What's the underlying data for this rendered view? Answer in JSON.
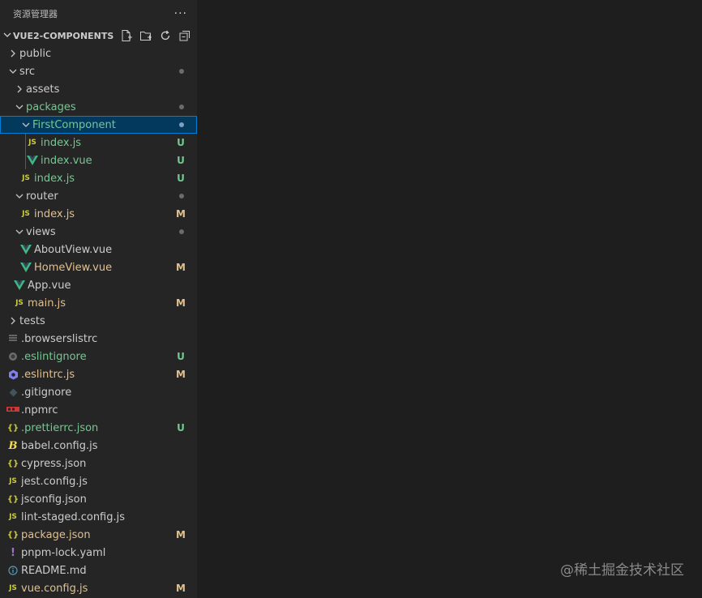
{
  "explorer": {
    "title": "资源管理器",
    "more": "···",
    "section_title": "VUE2-COMPONENTS",
    "actions": [
      "new-file-icon",
      "new-folder-icon",
      "refresh-icon",
      "collapse-all-icon"
    ]
  },
  "tree": [
    {
      "label": "public",
      "type": "folder",
      "open": false,
      "depth": 0
    },
    {
      "label": "src",
      "type": "folder",
      "open": true,
      "depth": 0,
      "status": "dot"
    },
    {
      "label": "assets",
      "type": "folder",
      "open": false,
      "depth": 1
    },
    {
      "label": "packages",
      "type": "folder",
      "open": true,
      "depth": 1,
      "status": "dot",
      "color": "green"
    },
    {
      "label": "FirstComponent",
      "type": "folder",
      "open": true,
      "depth": 2,
      "status": "dot",
      "color": "green",
      "selected": true
    },
    {
      "label": "index.js",
      "type": "js",
      "depth": 3,
      "status": "U",
      "color": "green"
    },
    {
      "label": "index.vue",
      "type": "vue",
      "depth": 3,
      "status": "U",
      "color": "green"
    },
    {
      "label": "index.js",
      "type": "js",
      "depth": 2,
      "status": "U",
      "color": "green"
    },
    {
      "label": "router",
      "type": "folder",
      "open": true,
      "depth": 1,
      "status": "dot"
    },
    {
      "label": "index.js",
      "type": "js",
      "depth": 2,
      "status": "M",
      "color": "yellow"
    },
    {
      "label": "views",
      "type": "folder",
      "open": true,
      "depth": 1,
      "status": "dot"
    },
    {
      "label": "AboutView.vue",
      "type": "vue",
      "depth": 2
    },
    {
      "label": "HomeView.vue",
      "type": "vue",
      "depth": 2,
      "status": "M",
      "color": "yellow"
    },
    {
      "label": "App.vue",
      "type": "vue",
      "depth": 1
    },
    {
      "label": "main.js",
      "type": "js",
      "depth": 1,
      "status": "M",
      "color": "yellow"
    },
    {
      "label": "tests",
      "type": "folder",
      "open": false,
      "depth": 0
    },
    {
      "label": ".browserslistrc",
      "type": "lines",
      "depth": 0
    },
    {
      "label": ".eslintignore",
      "type": "eslintignore",
      "depth": 0,
      "status": "U",
      "color": "green"
    },
    {
      "label": ".eslintrc.js",
      "type": "eslint",
      "depth": 0,
      "status": "M",
      "color": "yellow"
    },
    {
      "label": ".gitignore",
      "type": "git",
      "depth": 0
    },
    {
      "label": ".npmrc",
      "type": "npm",
      "depth": 0
    },
    {
      "label": ".prettierrc.json",
      "type": "json",
      "depth": 0,
      "status": "U",
      "color": "green"
    },
    {
      "label": "babel.config.js",
      "type": "babel",
      "depth": 0
    },
    {
      "label": "cypress.json",
      "type": "json",
      "depth": 0
    },
    {
      "label": "jest.config.js",
      "type": "js",
      "depth": 0
    },
    {
      "label": "jsconfig.json",
      "type": "json",
      "depth": 0
    },
    {
      "label": "lint-staged.config.js",
      "type": "js",
      "depth": 0
    },
    {
      "label": "package.json",
      "type": "json",
      "depth": 0,
      "status": "M",
      "color": "yellow"
    },
    {
      "label": "pnpm-lock.yaml",
      "type": "yaml",
      "depth": 0
    },
    {
      "label": "README.md",
      "type": "info",
      "depth": 0
    },
    {
      "label": "vue.config.js",
      "type": "js",
      "depth": 0,
      "status": "M",
      "color": "yellow"
    }
  ],
  "watermark": "@稀土掘金技术社区",
  "colors": {
    "sidebar": "#252526",
    "editor": "#1e1e1e",
    "selected": "#04395e",
    "untracked": "#73c991",
    "modified": "#e2c08d"
  }
}
